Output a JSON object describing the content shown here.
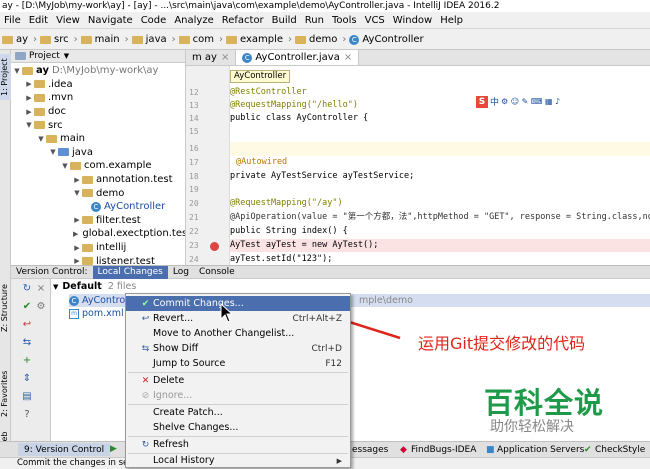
{
  "window": {
    "title": "ay - [D:\\MyJob\\my-work\\ay] - [ay] - ...\\src\\main\\java\\com\\example\\demo\\AyController.java - IntelliJ IDEA 2016.2"
  },
  "menu": [
    "File",
    "Edit",
    "View",
    "Navigate",
    "Code",
    "Analyze",
    "Refactor",
    "Build",
    "Run",
    "Tools",
    "VCS",
    "Window",
    "Help"
  ],
  "breadcrumbs": [
    "ay",
    "src",
    "main",
    "java",
    "com",
    "example",
    "demo",
    "AyController"
  ],
  "left_strip": {
    "project_tab": "1: Project",
    "structure_tab": "Z: Structure",
    "favorites_tab": "2: Favorites",
    "web_tab": "Web"
  },
  "project_panel": {
    "header": "Project",
    "tree": [
      {
        "label": "ay",
        "path": "D:\\MyJob\\my-work\\ay"
      },
      {
        "label": ".idea"
      },
      {
        "label": ".mvn"
      },
      {
        "label": "doc"
      },
      {
        "label": "src"
      },
      {
        "label": "main"
      },
      {
        "label": "java"
      },
      {
        "label": "com.example"
      },
      {
        "label": "annotation.test"
      },
      {
        "label": "demo"
      },
      {
        "label": "AyController"
      },
      {
        "label": "filter.test"
      },
      {
        "label": "global.exectption.test"
      },
      {
        "label": "intellij"
      },
      {
        "label": "listener.test"
      }
    ]
  },
  "editor": {
    "tabs": [
      {
        "label": "m ay"
      },
      {
        "label": "AyController.java"
      }
    ],
    "tooltip": "AyController",
    "line_numbers": [
      "12",
      "13",
      "14",
      "15",
      "16",
      "17",
      "18",
      "19",
      "20",
      "21",
      "22",
      "23",
      "24"
    ],
    "lines": [
      "@RestController",
      "@RequestMapping(\"/hello\")",
      "public class AyController {",
      "",
      "",
      "    @Autowired",
      "    private AyTestService ayTestService;",
      "",
      "    @RequestMapping(\"/ay\")",
      "    @ApiOperation(value = \"第一个方都，法\",httpMethod = \"GET\", response = String.class,note",
      "    public String index() {",
      "        AyTest ayTest = new AyTest();",
      "        ayTest.setId(\"123\");"
    ],
    "ime_toolbar": "中"
  },
  "version_control": {
    "tabs": [
      "Version Control:",
      "Local Changes",
      "Log",
      "Console"
    ],
    "changelist": {
      "name": "Default",
      "count": "2 files"
    },
    "files": [
      {
        "name": "AyController",
        "path": "mple\\demo"
      },
      {
        "name": "pom.xml"
      }
    ]
  },
  "context_menu": {
    "items": [
      {
        "label": "Commit Changes...",
        "shortcut": "",
        "icon": "commit-icon"
      },
      {
        "label": "Revert...",
        "shortcut": "Ctrl+Alt+Z",
        "icon": "revert-icon"
      },
      {
        "label": "Move to Another Changelist...",
        "shortcut": "",
        "icon": ""
      },
      {
        "label": "Show Diff",
        "shortcut": "Ctrl+D",
        "icon": "diff-icon"
      },
      {
        "label": "Jump to Source",
        "shortcut": "F12",
        "icon": ""
      },
      {
        "label": "Delete",
        "shortcut": "",
        "icon": "delete-icon"
      },
      {
        "label": "Ignore...",
        "shortcut": "",
        "icon": "ignore-icon"
      },
      {
        "label": "Create Patch...",
        "shortcut": "",
        "icon": ""
      },
      {
        "label": "Shelve Changes...",
        "shortcut": "",
        "icon": ""
      },
      {
        "label": "Refresh",
        "shortcut": "",
        "icon": "refresh-icon"
      },
      {
        "label": "Local History",
        "shortcut": "",
        "icon": ""
      }
    ]
  },
  "annotation": {
    "text": "运用Git提交修改的代码",
    "color": "#e0241b"
  },
  "watermark": {
    "title": "百科全说",
    "subtitle": "助你轻松解决"
  },
  "bottom_tabs": [
    "9: Version Control",
    "essages",
    "FindBugs-IDEA",
    "Application Servers",
    "CheckStyle"
  ],
  "status": "Commit the changes in sel",
  "colors": {
    "selection": "#4b6eaf",
    "annotation": "#e0241b",
    "watermark": "#1f9a4a"
  }
}
